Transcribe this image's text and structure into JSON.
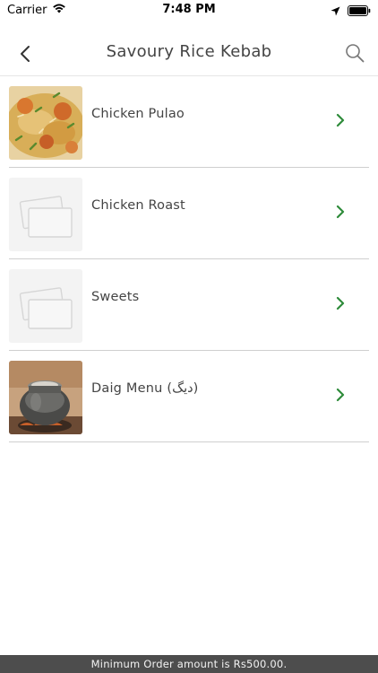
{
  "status_bar": {
    "carrier": "Carrier",
    "time": "7:48 PM"
  },
  "header": {
    "title": "Savoury Rice Kebab"
  },
  "menu": {
    "items": [
      {
        "label": "Chicken Pulao",
        "image": "chicken-pulao-photo"
      },
      {
        "label": "Chicken Roast",
        "image": "placeholder-image-icon"
      },
      {
        "label": "Sweets",
        "image": "placeholder-image-icon"
      },
      {
        "label": "Daig Menu (دیگ)",
        "image": "daig-pot-photo"
      }
    ]
  },
  "footer": {
    "notice": "Minimum Order amount is Rs500.00."
  },
  "colors": {
    "chevron": "#2e8b3a",
    "footer_bg": "#4d4d4d",
    "divider": "#cfcfcf"
  }
}
